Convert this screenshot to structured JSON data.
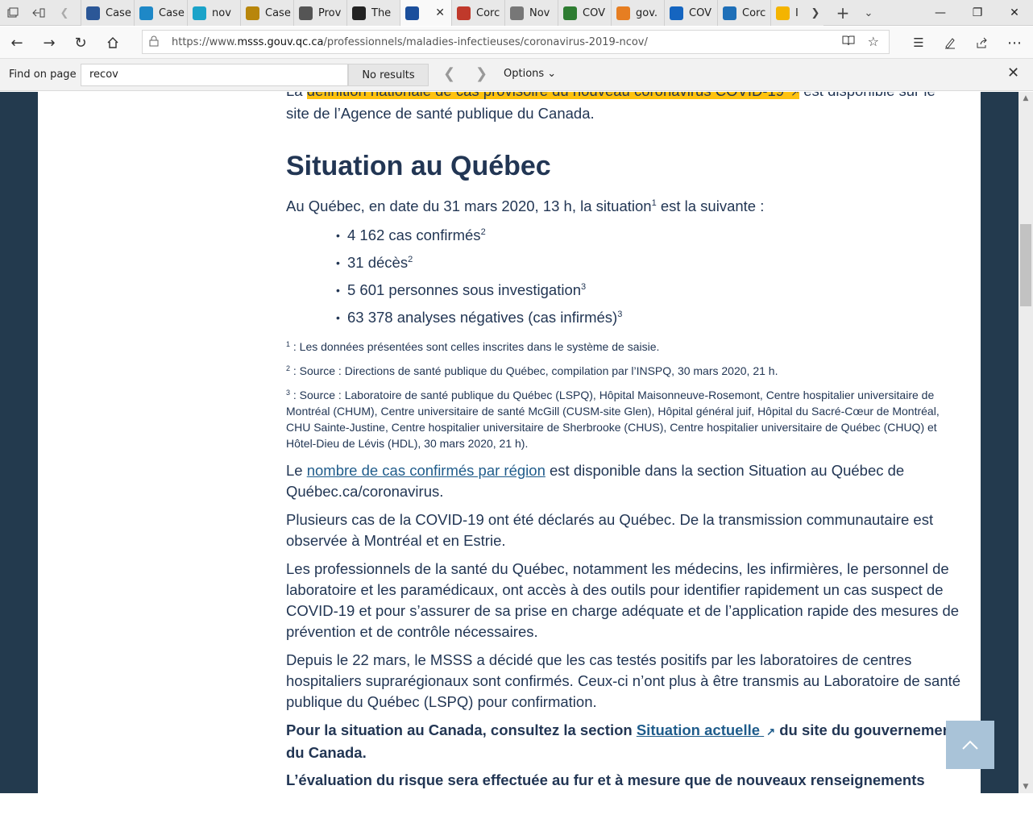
{
  "browser": {
    "tabs": [
      {
        "title": "Case",
        "favicon": "windows-tile-icon",
        "color": "#2b5797"
      },
      {
        "title": "Case",
        "favicon": "chart-icon",
        "color": "#1e88c7"
      },
      {
        "title": "nov",
        "favicon": "medical-cross-icon",
        "color": "#1aa3c9"
      },
      {
        "title": "Case",
        "favicon": "document-icon",
        "color": "#b8860b"
      },
      {
        "title": "Prov",
        "favicon": "car-icon",
        "color": "#555555"
      },
      {
        "title": "The",
        "favicon": "shield-icon",
        "color": "#222222"
      },
      {
        "title": "",
        "favicon": "fleur-de-lis-icon",
        "color": "#1b4f9c",
        "active": true
      },
      {
        "title": "Corc",
        "favicon": "pen-icon",
        "color": "#c0392b"
      },
      {
        "title": "Nov",
        "favicon": "news-icon",
        "color": "#777777"
      },
      {
        "title": "COV",
        "favicon": "cloud-icon",
        "color": "#2e7d32"
      },
      {
        "title": "gov.",
        "favicon": "leaf-icon",
        "color": "#e67e22"
      },
      {
        "title": "COV",
        "favicon": "globe-icon",
        "color": "#1565c0"
      },
      {
        "title": "Corc",
        "favicon": "arch-icon",
        "color": "#1e6fb8"
      },
      {
        "title": "I",
        "favicon": "crown-icon",
        "color": "#f4b400"
      }
    ],
    "url_prefix": "https://www.",
    "url_domain": "msss.gouv.qc.ca",
    "url_path": "/professionnels/maladies-infectieuses/coronavirus-2019-ncov/",
    "find": {
      "label": "Find on page",
      "query": "recov",
      "status": "No results",
      "options": "Options"
    }
  },
  "page": {
    "intro_prefix": "La ",
    "intro_highlight": "définition nationale de cas provisoire du nouveau coronavirus COVID-19",
    "intro_suffix": " est disponible sur le",
    "intro_line2": "site de l’Agence de santé publique du Canada.",
    "heading": "Situation au Québec",
    "status_text_a": "Au Québec, en date du 31 mars 2020, 13 h, la situation",
    "status_sup": "1",
    "status_text_b": " est la suivante :",
    "stats": [
      {
        "text": "4 162 cas confirmés",
        "sup": "2"
      },
      {
        "text": "31 décès",
        "sup": "2"
      },
      {
        "text": "5 601 personnes sous investigation",
        "sup": "3"
      },
      {
        "text": "63 378 analyses négatives (cas infirmés)",
        "sup": "3"
      }
    ],
    "footnotes": [
      {
        "num": "1",
        "text": " : Les données présentées sont celles inscrites dans le système de saisie."
      },
      {
        "num": "2",
        "text": " : Source : Directions de santé publique du Québec, compilation par l’INSPQ, 30 mars 2020, 21 h."
      },
      {
        "num": "3",
        "text": " : Source : Laboratoire de santé publique du Québec (LSPQ), Hôpital Maisonneuve-Rosemont, Centre hospitalier universitaire de Montréal (CHUM), Centre universitaire de santé McGill (CUSM-site Glen), Hôpital général juif, Hôpital du Sacré-Cœur de Montréal, CHU Sainte-Justine, Centre hospitalier universitaire de Sherbrooke (CHUS), Centre hospitalier universitaire de Québec (CHUQ) et Hôtel-Dieu de Lévis (HDL), 30 mars 2020, 21 h)."
      }
    ],
    "region_prefix": "Le ",
    "region_link": "nombre de cas confirmés par région",
    "region_suffix": " est disponible dans la section Situation au Québec de Québec.ca/coronavirus.",
    "para1": "Plusieurs cas de la COVID-19 ont été déclarés au Québec. De la transmission communautaire est observée à Montréal et en Estrie.",
    "para2": "Les professionnels de la santé du Québec, notamment les médecins, les infirmières, le personnel de laboratoire et les paramédicaux, ont accès à des outils pour identifier rapidement un cas suspect de COVID-19 et pour s’assurer de sa prise en charge adéquate et de l’application rapide des mesures de prévention et de contrôle nécessaires.",
    "para3": "Depuis le 22 mars, le MSSS a décidé que les cas testés positifs par les laboratoires de centres hospitaliers suprarégionaux sont confirmés. Ceux-ci n’ont plus à être transmis au Laboratoire de santé publique du Québec (LSPQ) pour confirmation.",
    "canada_prefix": "Pour la situation au Canada, consultez la section ",
    "canada_link": "Situation actuelle",
    "canada_suffix": " du site du gouvernement du Canada.",
    "risk_text": "L’évaluation du risque sera effectuée au fur et à mesure que de nouveaux renseignements"
  },
  "colors": {
    "highlight": "#ffc20e",
    "text": "#223654",
    "link": "#1f5c8b",
    "page_frame": "#233a4e",
    "back_to_top": "#a9c3d8"
  }
}
